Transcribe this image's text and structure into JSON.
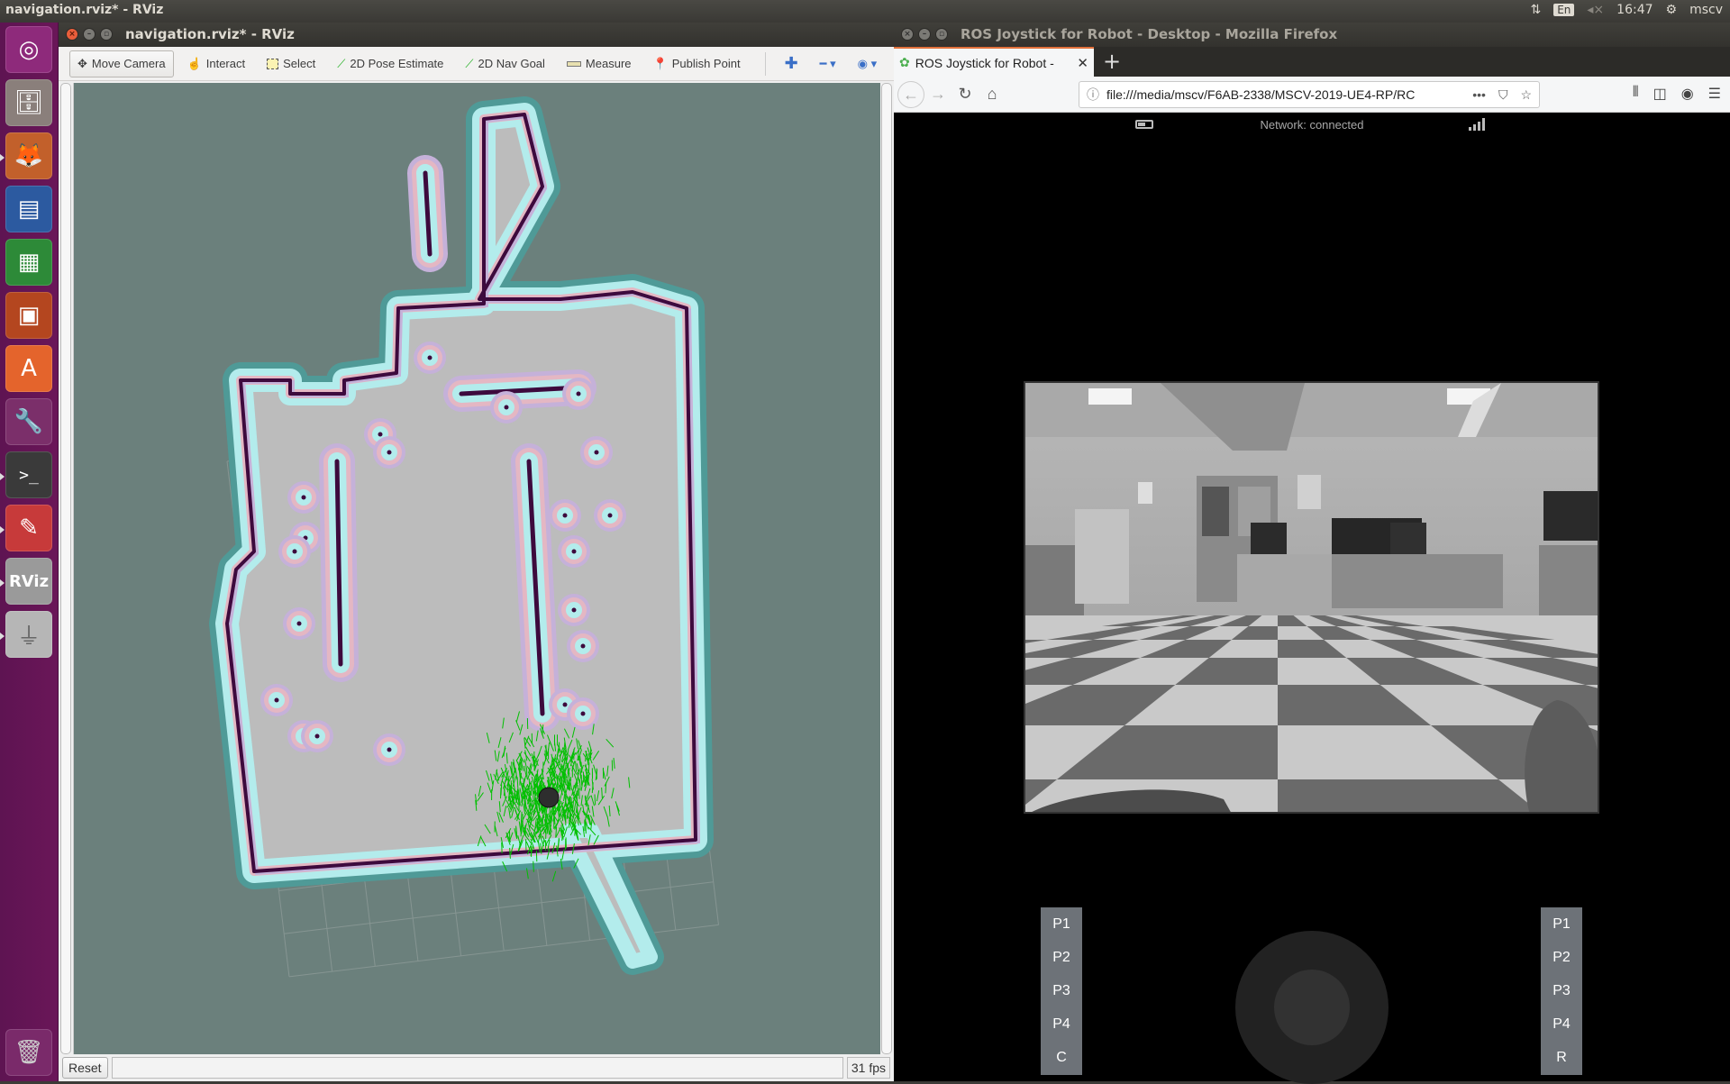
{
  "top_panel": {
    "active_window_title": "navigation.rviz* - RViz",
    "keyboard_layout": "En",
    "clock": "16:47",
    "user": "mscv"
  },
  "launcher": {
    "items": [
      {
        "name": "ubuntu-dash",
        "color": "#8e2a7b"
      },
      {
        "name": "files",
        "color": "#8a7f7b"
      },
      {
        "name": "firefox",
        "color": "#c2602b"
      },
      {
        "name": "libreoffice-writer",
        "color": "#2c5aa0"
      },
      {
        "name": "libreoffice-calc",
        "color": "#2d8a38"
      },
      {
        "name": "libreoffice-impress",
        "color": "#b4461f"
      },
      {
        "name": "ubuntu-software",
        "color": "#e4642c"
      },
      {
        "name": "system-settings",
        "color": "#7b2f6a"
      },
      {
        "name": "terminal",
        "color": "#3a3a3a"
      },
      {
        "name": "evince",
        "color": "#c73a3a"
      },
      {
        "name": "rviz",
        "color": "#9a9a9a"
      },
      {
        "name": "usb-drive",
        "color": "#b6b6b6"
      }
    ],
    "trash": {
      "name": "trash"
    }
  },
  "rviz": {
    "window_title": "navigation.rviz* - RViz",
    "toolbar": {
      "move_camera": "Move Camera",
      "interact": "Interact",
      "select": "Select",
      "pose_estimate": "2D Pose Estimate",
      "nav_goal": "2D Nav Goal",
      "measure": "Measure",
      "publish_point": "Publish Point"
    },
    "status": {
      "reset": "Reset",
      "fps": "31 fps"
    },
    "colors": {
      "background": "#6b807c",
      "free_space": "#bcbcbc",
      "obstacle": "#3d0a3d",
      "inflation_cyan": "#b3ecec",
      "inflation_teal": "#4f9a97",
      "inflation_pink": "#e4b7c3",
      "inflation_lavender": "#c5b1d9",
      "particles": "#00c000",
      "robot": "#2e2e2e"
    }
  },
  "firefox": {
    "window_title": "ROS Joystick for Robot - Desktop - Mozilla Firefox",
    "tab_label": "ROS Joystick for Robot -",
    "url": "file:///media/mscv/F6AB-2338/MSCV-2019-UE4-RP/RC",
    "page": {
      "network_status": "Network: connected",
      "left_buttons": [
        "P1",
        "P2",
        "P3",
        "P4",
        "C"
      ],
      "right_buttons": [
        "P1",
        "P2",
        "P3",
        "P4",
        "R"
      ]
    }
  }
}
